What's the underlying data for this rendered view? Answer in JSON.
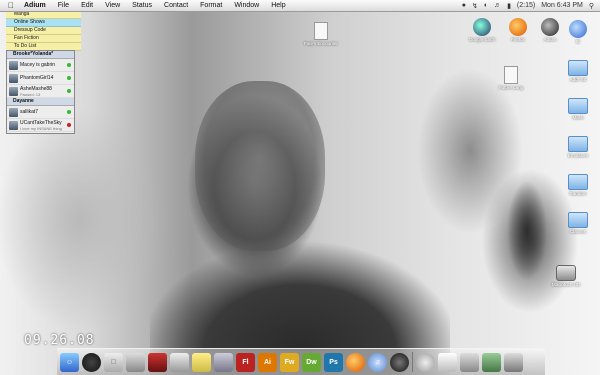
{
  "menubar": {
    "app_name": "Adium",
    "items": [
      "File",
      "Edit",
      "View",
      "Status",
      "Contact",
      "Format",
      "Window",
      "Help"
    ],
    "battery": "(2:15)",
    "clock": "Mon 6:43 PM"
  },
  "notes": [
    {
      "label": "Manga",
      "color": "#f6f0a6"
    },
    {
      "label": "Online Shows",
      "color": "#a9e2f4"
    },
    {
      "label": "Dressup Code",
      "color": "#f6f0a6"
    },
    {
      "label": "Fan Fiction",
      "color": "#f6f0a6"
    },
    {
      "label": "To Do List",
      "color": "#f6f0a6"
    }
  ],
  "buddy_list": {
    "groups": [
      {
        "name": "Brooke*Yolanda*",
        "buddies": [
          {
            "name": "Macey is gabrin",
            "status": "on",
            "sub": ""
          },
          {
            "name": "PhantomGirl14",
            "status": "on",
            "sub": ""
          },
          {
            "name": "AsheMashe88",
            "status": "on",
            "sub": "Paused: 13"
          }
        ]
      },
      {
        "name": "Dayanne",
        "buddies": [
          {
            "name": "sallikat7",
            "status": "on",
            "sub": ""
          },
          {
            "name": "UCantTakeTheSky",
            "status": "away",
            "sub": "I love my INSANE thing"
          }
        ]
      }
    ]
  },
  "desktop_icons": {
    "fate": "Fate's Encounter",
    "google_earth": "Google Earth",
    "firefox": "Firefox",
    "adium": "Adium",
    "ie": "IE",
    "future_lang": "Future Lang",
    "folder_1": "Add'l Stf",
    "folder_2": "Mash",
    "folder_3": "Emulators",
    "folder_4": "Random",
    "folder_5": "Classes",
    "hd": "Macintosh HD"
  },
  "date_text": "09.26.08",
  "dock": [
    "finder",
    "dashboard",
    "apple",
    "calculator",
    "red-app",
    "photo-app",
    "stickies",
    "network",
    "Fl",
    "Ai",
    "Fw",
    "Dw",
    "Ps",
    "firefox",
    "itunes",
    "adium",
    "|",
    "sync",
    "preview",
    "photos",
    "terminal",
    "trash"
  ]
}
